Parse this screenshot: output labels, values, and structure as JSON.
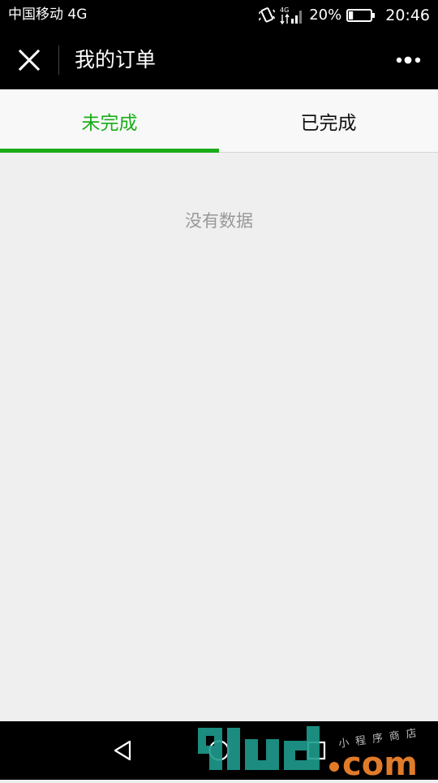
{
  "status_bar": {
    "carrier": "中国移动 4G",
    "network_badge": "4G",
    "battery_percent": "20%",
    "battery_level": 0.2,
    "time": "20:46"
  },
  "nav": {
    "title": "我的订单"
  },
  "tabs": [
    {
      "label": "未完成",
      "active": true
    },
    {
      "label": "已完成",
      "active": false
    }
  ],
  "content": {
    "empty_text": "没有数据"
  },
  "watermark": {
    "text": "91ud.com",
    "tagline": "小程序商店"
  },
  "colors": {
    "accent": "#1aad19",
    "bar": "#000000",
    "background": "#efefef"
  },
  "icons": {
    "close": "close-icon",
    "more": "more-dots-icon",
    "back": "back-triangle-icon",
    "home": "home-circle-icon",
    "recent": "recent-square-icon"
  }
}
